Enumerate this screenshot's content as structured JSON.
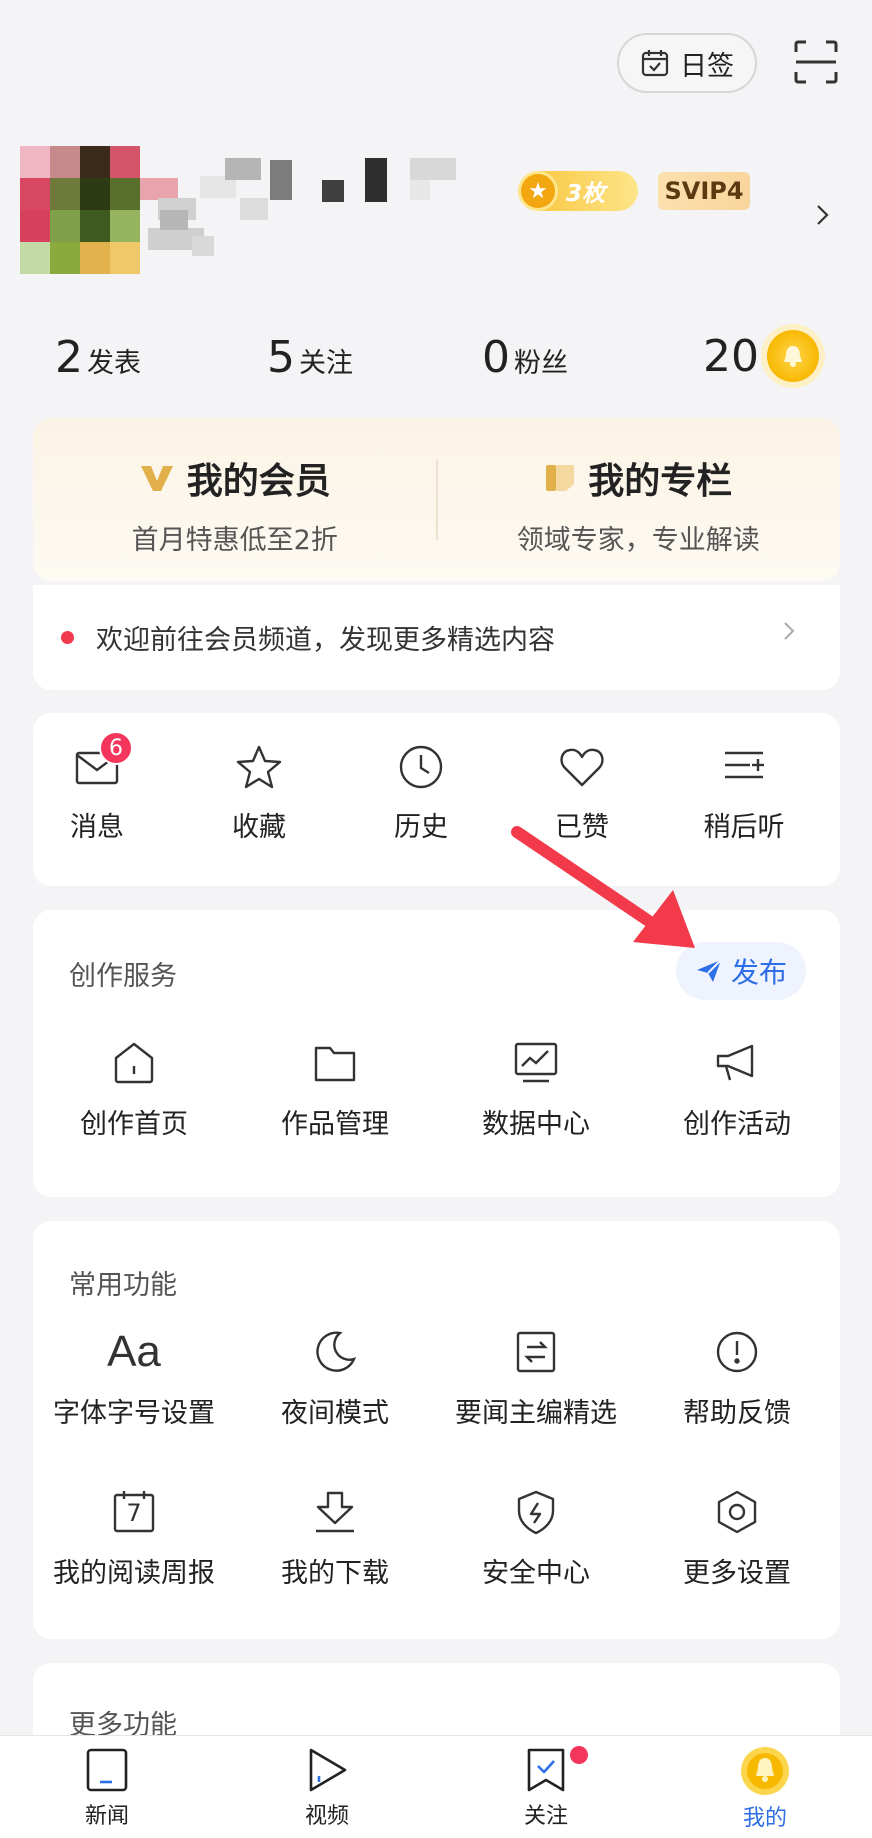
{
  "topbar": {
    "checkin_label": "日签"
  },
  "profile": {
    "medal_count": "3枚",
    "vip_level": "SVIP4"
  },
  "stats": [
    {
      "num": "2",
      "label": "发表"
    },
    {
      "num": "5",
      "label": "关注"
    },
    {
      "num": "0",
      "label": "粉丝"
    }
  ],
  "coins": "20",
  "member": {
    "vip_title": "我的会员",
    "vip_sub": "首月特惠低至2折",
    "column_title": "我的专栏",
    "column_sub": "领域专家，专业解读",
    "notice": "欢迎前往会员频道，发现更多精选内容"
  },
  "quick": {
    "messages": "消息",
    "messages_badge": "6",
    "favorites": "收藏",
    "history": "历史",
    "liked": "已赞",
    "listen_later": "稍后听"
  },
  "create": {
    "title": "创作服务",
    "publish": "发布",
    "home": "创作首页",
    "works": "作品管理",
    "data": "数据中心",
    "events": "创作活动"
  },
  "common": {
    "title": "常用功能",
    "font_glyph": "Aa",
    "font": "字体字号设置",
    "night": "夜间模式",
    "editor_pick": "要闻主编精选",
    "help": "帮助反馈",
    "calendar_day": "7",
    "weekly": "我的阅读周报",
    "downloads": "我的下载",
    "security": "安全中心",
    "more_settings": "更多设置"
  },
  "more": {
    "title": "更多功能"
  },
  "nav": {
    "news": "新闻",
    "video": "视频",
    "follow": "关注",
    "mine": "我的"
  },
  "colors": {
    "accent": "#2e6ee6",
    "badge": "#f5365c",
    "coin": "#f7b800"
  }
}
